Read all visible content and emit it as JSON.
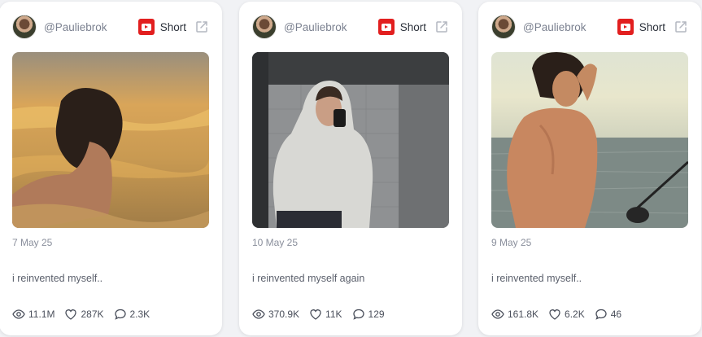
{
  "posts": [
    {
      "handle": "@Pauliebrok",
      "type_label": "Short",
      "date": "7 May 25",
      "caption": "i reinvented myself..",
      "views": "11.1M",
      "likes": "287K",
      "comments": "2.3K"
    },
    {
      "handle": "@Pauliebrok",
      "type_label": "Short",
      "date": "10 May 25",
      "caption": "i reinvented myself again",
      "views": "370.9K",
      "likes": "11K",
      "comments": "129"
    },
    {
      "handle": "@Pauliebrok",
      "type_label": "Short",
      "date": "9 May 25",
      "caption": "i reinvented myself..",
      "views": "161.8K",
      "likes": "6.2K",
      "comments": "46"
    }
  ],
  "icons": {
    "platform": "youtube-icon",
    "external": "external-link-icon",
    "views": "eye-icon",
    "likes": "heart-icon",
    "comments": "comment-icon"
  },
  "colors": {
    "youtube_red": "#e21f1f",
    "card_bg": "#ffffff",
    "page_bg": "#f1f2f5"
  }
}
